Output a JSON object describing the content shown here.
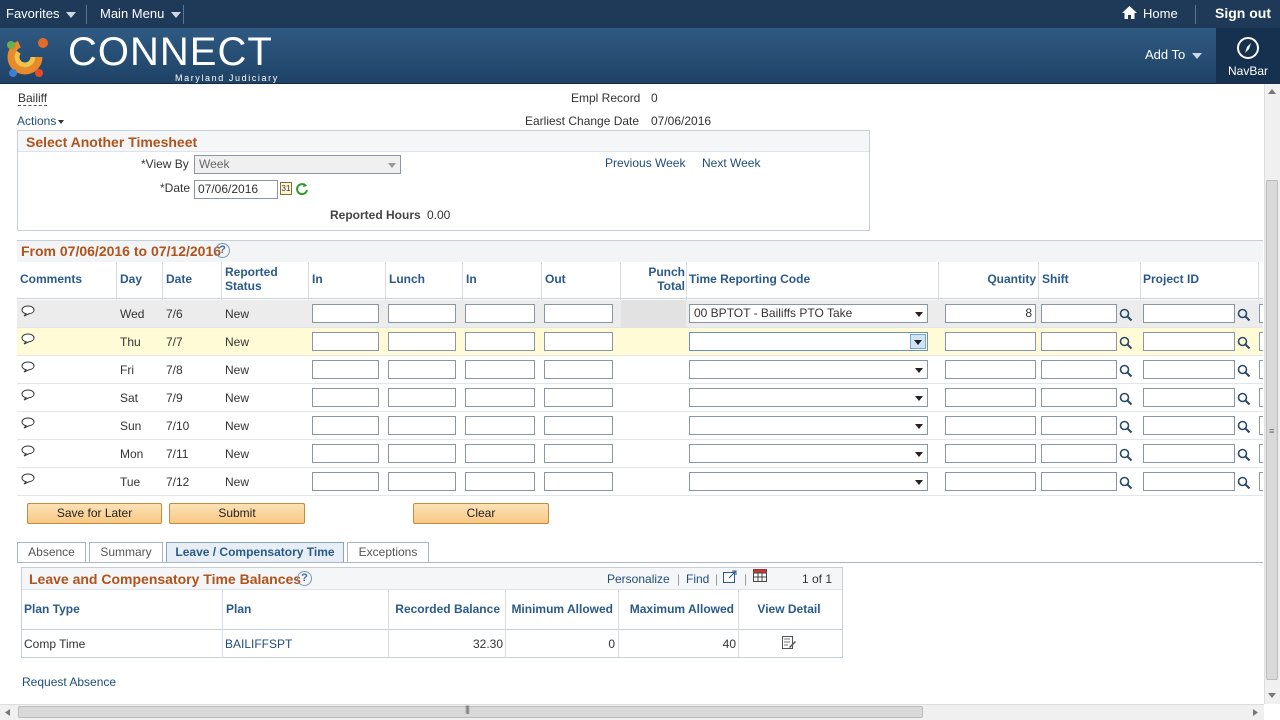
{
  "topbar": {
    "favorites": "Favorites",
    "main_menu": "Main Menu",
    "home": "Home",
    "sign_out": "Sign out"
  },
  "brand": {
    "logo_text": "CONNECT",
    "logo_sub": "Maryland Judiciary",
    "add_to": "Add To",
    "navbar": "NavBar"
  },
  "header": {
    "job_title": "Bailiff",
    "actions": "Actions",
    "empl_record_label": "Empl Record",
    "empl_record_value": "0",
    "earliest_change_label": "Earliest Change Date",
    "earliest_change_value": "07/06/2016"
  },
  "select_timesheet": {
    "title": "Select Another Timesheet",
    "view_by_label": "*View By",
    "view_by_value": "Week",
    "date_label": "*Date",
    "date_value": "07/06/2016",
    "previous_week": "Previous Week",
    "next_week": "Next Week",
    "reported_hours_label": "Reported Hours",
    "reported_hours_value": "0.00"
  },
  "timesheet": {
    "period_title": "From 07/06/2016 to 07/12/2016",
    "columns": {
      "comments": "Comments",
      "day": "Day",
      "date": "Date",
      "reported_status": "Reported Status",
      "in1": "In",
      "lunch": "Lunch",
      "in2": "In",
      "out": "Out",
      "punch_total": "Punch Total",
      "trc": "Time Reporting Code",
      "quantity": "Quantity",
      "shift": "Shift",
      "project_id": "Project ID"
    },
    "rows": [
      {
        "day": "Wed",
        "date": "7/6",
        "status": "New",
        "trc": "00 BPTOT - Bailiffs PTO Take",
        "quantity": "8"
      },
      {
        "day": "Thu",
        "date": "7/7",
        "status": "New",
        "trc": "",
        "quantity": ""
      },
      {
        "day": "Fri",
        "date": "7/8",
        "status": "New",
        "trc": "",
        "quantity": ""
      },
      {
        "day": "Sat",
        "date": "7/9",
        "status": "New",
        "trc": "",
        "quantity": ""
      },
      {
        "day": "Sun",
        "date": "7/10",
        "status": "New",
        "trc": "",
        "quantity": ""
      },
      {
        "day": "Mon",
        "date": "7/11",
        "status": "New",
        "trc": "",
        "quantity": ""
      },
      {
        "day": "Tue",
        "date": "7/12",
        "status": "New",
        "trc": "",
        "quantity": ""
      }
    ]
  },
  "buttons": {
    "save_later": "Save for Later",
    "submit": "Submit",
    "clear": "Clear"
  },
  "tabs": [
    "Absence",
    "Summary",
    "Leave / Compensatory Time",
    "Exceptions"
  ],
  "leave": {
    "title": "Leave and Compensatory Time Balances",
    "personalize": "Personalize",
    "find": "Find",
    "pagination": "1 of 1",
    "columns": {
      "plan_type": "Plan Type",
      "plan": "Plan",
      "recorded_balance": "Recorded Balance",
      "minimum_allowed": "Minimum Allowed",
      "maximum_allowed": "Maximum Allowed",
      "view_detail": "View Detail"
    },
    "rows": [
      {
        "plan_type": "Comp Time",
        "plan": "BAILIFFSPT",
        "recorded_balance": "32.30",
        "minimum_allowed": "0",
        "maximum_allowed": "40"
      }
    ]
  },
  "request_absence": "Request Absence",
  "colors": {
    "topbar": "#1e3a58",
    "brand": "#2f5a82",
    "section_title": "#b0531c",
    "link": "#1f4d7a",
    "button": "#f8c884",
    "highlight_row": "#fffbd6"
  }
}
